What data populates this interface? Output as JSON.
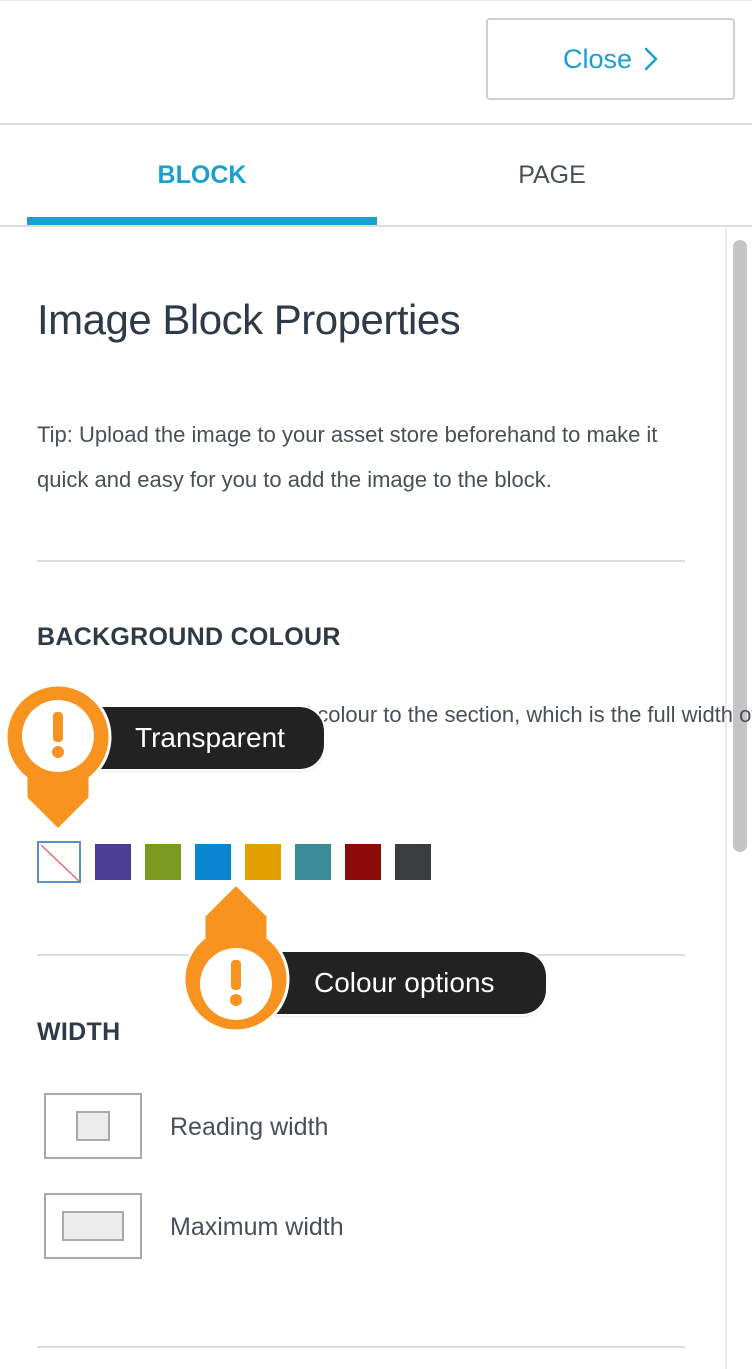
{
  "header": {
    "close_label": "Close",
    "close_icon": "chevron-right-icon"
  },
  "tabs": [
    {
      "label": "BLOCK",
      "active": true
    },
    {
      "label": "PAGE",
      "active": false
    }
  ],
  "panel": {
    "title": "Image Block Properties",
    "tip": "Tip: Upload the image to your asset store beforehand to make it quick and easy for you to add the image to the block."
  },
  "background": {
    "heading": "BACKGROUND COLOUR",
    "description": "applies a background colour to the section, which is the full width of",
    "swatches": [
      {
        "name": "transparent",
        "color": "transparent"
      },
      {
        "name": "purple",
        "color": "#4b3c96"
      },
      {
        "name": "green",
        "color": "#7a9a22"
      },
      {
        "name": "blue",
        "color": "#0a86d0"
      },
      {
        "name": "orange",
        "color": "#e0a000"
      },
      {
        "name": "teal",
        "color": "#3a8d96"
      },
      {
        "name": "red",
        "color": "#8c0a0a"
      },
      {
        "name": "dark-grey",
        "color": "#3a3c40"
      }
    ]
  },
  "width": {
    "heading": "WIDTH",
    "options": [
      {
        "label": "Reading width"
      },
      {
        "label": "Maximum width"
      }
    ]
  },
  "callouts": {
    "transparent": "Transparent",
    "colour_options": "Colour options",
    "pin_icon": "exclamation-icon",
    "accent_color": "#f7931e"
  }
}
